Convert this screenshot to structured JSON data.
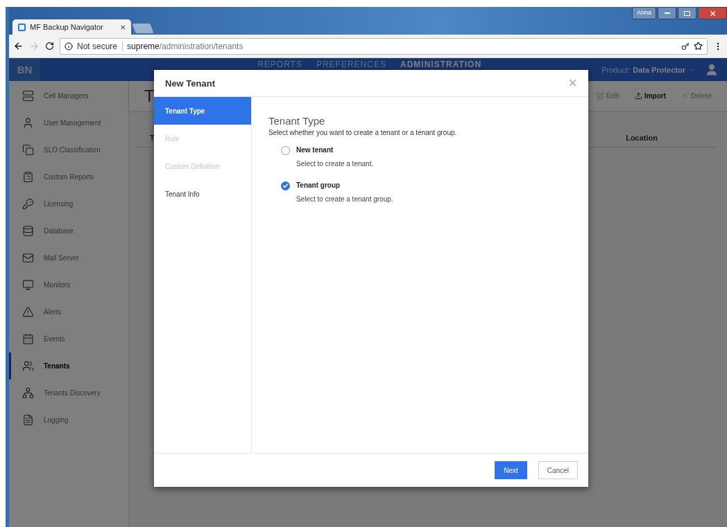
{
  "browser": {
    "user": "Anna",
    "tab": {
      "title": "MF Backup Navigator",
      "close": "×"
    },
    "security": "Not secure",
    "url_host": "supreme",
    "url_path": "/administration/tenants"
  },
  "app": {
    "logo": "BN",
    "nav": [
      {
        "label": "REPORTS",
        "selected": false
      },
      {
        "label": "PREFERENCES",
        "selected": false
      },
      {
        "label": "ADMINISTRATION",
        "selected": true
      }
    ],
    "product_label": "Product:",
    "product": "Data Protector"
  },
  "sidebar": {
    "items": [
      {
        "label": "Cell Managers",
        "selected": false
      },
      {
        "label": "User Management",
        "selected": false
      },
      {
        "label": "SLO Classification",
        "selected": false
      },
      {
        "label": "Custom Reports",
        "selected": false
      },
      {
        "label": "Licensing",
        "selected": false
      },
      {
        "label": "Database",
        "selected": false
      },
      {
        "label": "Mail Server",
        "selected": false
      },
      {
        "label": "Monitors",
        "selected": false
      },
      {
        "label": "Alerts",
        "selected": false
      },
      {
        "label": "Events",
        "selected": false
      },
      {
        "label": "Tenants",
        "selected": true
      },
      {
        "label": "Tenants Discovery",
        "selected": false
      },
      {
        "label": "Logging",
        "selected": false
      }
    ]
  },
  "page": {
    "title": "T",
    "actions": [
      {
        "label": "Edit",
        "disabled": true
      },
      {
        "label": "Import",
        "disabled": false
      },
      {
        "label": "Delete",
        "disabled": true
      }
    ],
    "table": {
      "columns": [
        "T",
        "Location"
      ]
    }
  },
  "dialog": {
    "title": "New Tenant",
    "close": "×",
    "steps": [
      {
        "label": "Tenant Type",
        "selected": true,
        "disabled": false
      },
      {
        "label": "Rule",
        "selected": false,
        "disabled": true
      },
      {
        "label": "Custom Definition",
        "selected": false,
        "disabled": true
      },
      {
        "label": "Tenant Info",
        "selected": false,
        "disabled": false
      }
    ],
    "heading": "Tenant Type",
    "description": "Select whether you want to create a tenant or a tenant group.",
    "options": [
      {
        "label": "New tenant",
        "hint": "Select to create a tenant.",
        "selected": false
      },
      {
        "label": "Tenant group",
        "hint": "Select to create a tenant group.",
        "selected": true
      }
    ],
    "buttons": [
      {
        "label": "Next",
        "kind": "primary"
      },
      {
        "label": "Cancel",
        "kind": "secondary"
      }
    ]
  }
}
